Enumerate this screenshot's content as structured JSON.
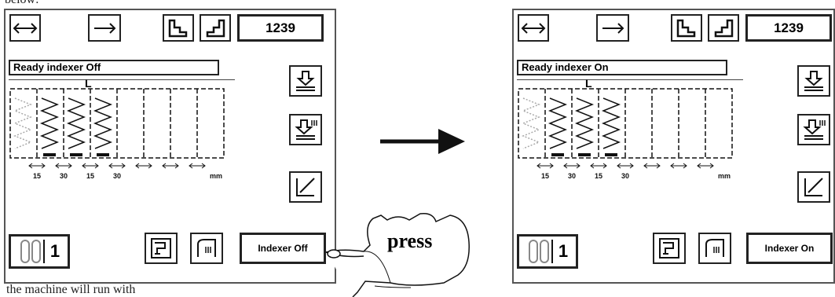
{
  "panels": [
    {
      "counter": "1239",
      "status": "Ready indexer Off",
      "profile_letter": "L",
      "spacings": [
        "15",
        "30",
        "15",
        "30"
      ],
      "unit": "mm",
      "bobbin_count": "1",
      "indexer_label": "Indexer Off"
    },
    {
      "counter": "1239",
      "status": "Ready indexer On",
      "profile_letter": "L",
      "spacings": [
        "15",
        "30",
        "15",
        "30"
      ],
      "unit": "mm",
      "bobbin_count": "1",
      "indexer_label": "Indexer On"
    }
  ],
  "callout": "press",
  "top_snippet": "below:",
  "bottom_snippet": "the machine will run with",
  "icons": [
    "left-right-arrow-icon",
    "right-arrow-icon",
    "step-left-icon",
    "step-right-icon",
    "presser-down-icon",
    "presser-triple-icon",
    "diagonal-icon",
    "machine-icon",
    "thread-icon",
    "bobbin-icon",
    "hand-pointer-icon",
    "transition-arrow-icon"
  ]
}
